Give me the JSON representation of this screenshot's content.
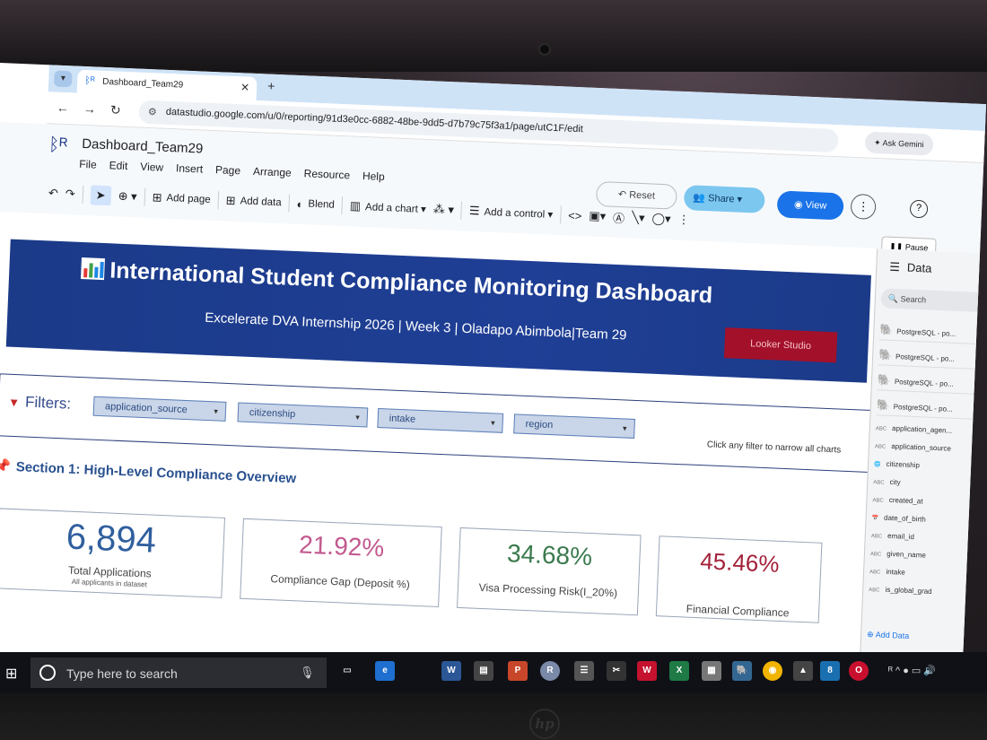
{
  "browser": {
    "tab_title": "Dashboard_Team29",
    "tab_close": "✕",
    "new_tab": "+",
    "url": "datastudio.google.com/u/0/reporting/91d3e0cc-6882-48be-9dd5-d7b79c75f3a1/page/utC1F/edit",
    "ask_gemini": "✦ Ask Gemini"
  },
  "app": {
    "report_title": "Dashboard_Team29",
    "menu": [
      "File",
      "Edit",
      "View",
      "Insert",
      "Page",
      "Arrange",
      "Resource",
      "Help"
    ],
    "toolbar": {
      "add_page": "Add page",
      "add_data": "Add data",
      "blend": "Blend",
      "add_chart": "Add a chart ▾",
      "add_control": "Add a control ▾"
    },
    "reset": "Reset",
    "share": "Share",
    "view": "View",
    "pause": "Pause"
  },
  "dashboard": {
    "title": "International Student  Compliance Monitoring Dashboard",
    "subtitle": "Excelerate DVA Internship 2026 | Week 3 | Oladapo Abimbola|Team 29",
    "badge": "Looker Studio",
    "filters_label": "Filters:",
    "filters": [
      "application_source",
      "citizenship",
      "intake",
      "region"
    ],
    "filter_hint": "Click any filter to narrow all charts",
    "section1_title": "Section 1: High-Level Compliance Overview",
    "kpis": [
      {
        "value": "6,894",
        "label": "Total Applications",
        "sub": "All applicants in dataset",
        "color": "#2f5f9e"
      },
      {
        "value": "21.92%",
        "label": "Compliance Gap (Deposit %)",
        "sub": "",
        "color": "#c2598e"
      },
      {
        "value": "34.68%",
        "label": "Visa Processing Risk(I_20%)",
        "sub": "",
        "color": "#3b7a4e"
      },
      {
        "value": "45.46%",
        "label": "Financial Compliance",
        "sub": "",
        "color": "#a3213a"
      }
    ]
  },
  "data_panel": {
    "title": "Data",
    "search": "Search",
    "sources": [
      "PostgreSQL - po...",
      "PostgreSQL - po...",
      "PostgreSQL - po...",
      "PostgreSQL - po..."
    ],
    "fields": [
      "application_agen...",
      "application_source",
      "citizenship",
      "city",
      "created_at",
      "date_of_birth",
      "email_id",
      "given_name",
      "intake",
      "is_global_grad"
    ],
    "add_data": "Add Data"
  },
  "taskbar": {
    "search_placeholder": "Type here to search"
  }
}
